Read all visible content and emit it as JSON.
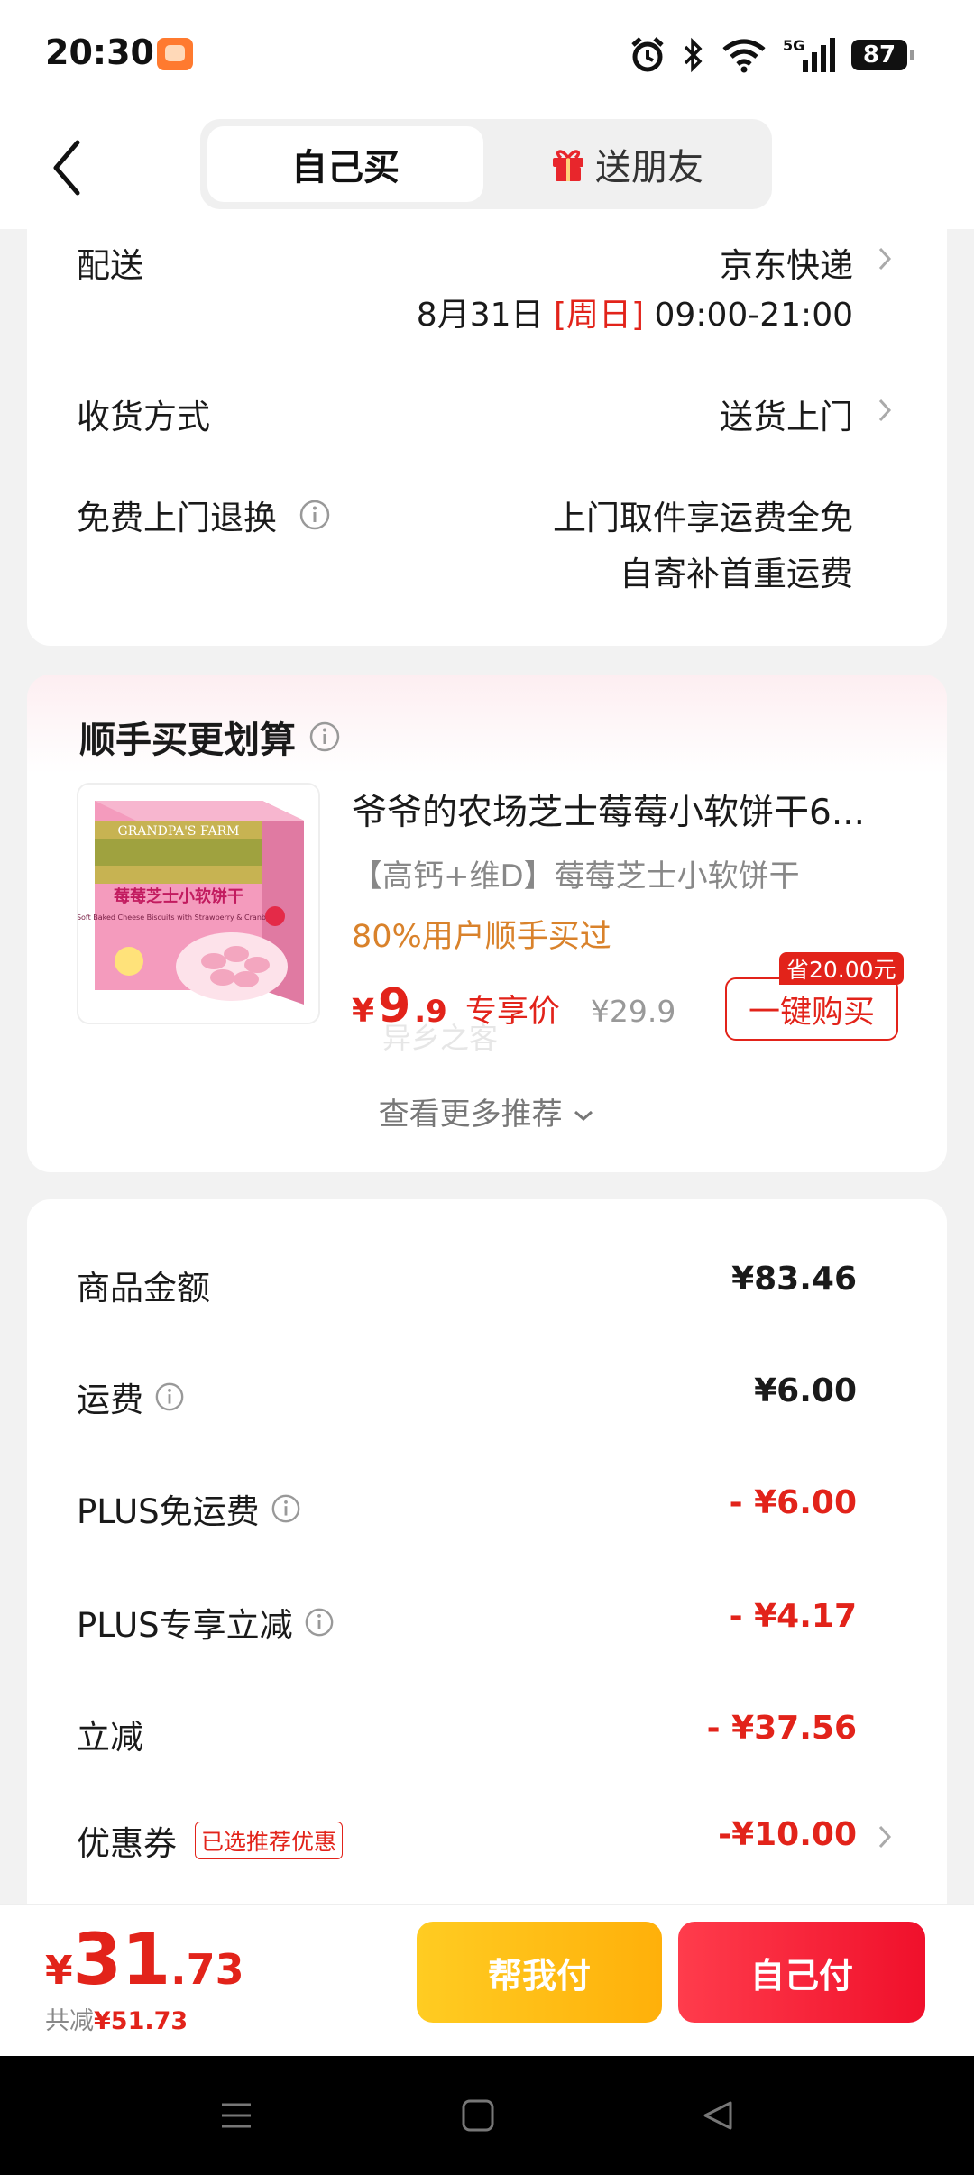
{
  "status_bar": {
    "time": "20:30",
    "battery": "87"
  },
  "header": {
    "tab_self": "自己买",
    "tab_gift": "送朋友"
  },
  "delivery": {
    "delivery_label": "配送",
    "carrier": "京东快递",
    "date": "8月31日",
    "weekday": "[周日]",
    "time_window": "09:00-21:00",
    "receive_label": "收货方式",
    "receive_value": "送货上门",
    "return_label": "免费上门退换",
    "return_line1": "上门取件享运费全免",
    "return_line2": "自寄补首重运费"
  },
  "recommend": {
    "title": "顺手买更划算",
    "product_name": "爷爷的农场芝士莓莓小软饼干6...",
    "product_sub": "【高钙+维D】莓莓芝士小软饼干",
    "product_tag": "80%用户顺手买过",
    "price_symbol": "¥",
    "price_int": "9",
    "price_dec": ".9",
    "price_label": "专享价",
    "original_price": "¥29.9",
    "save_badge": "省20.00元",
    "buy_button": "一键购买",
    "more": "查看更多推荐",
    "package_brand": "GRANDPA'S FARM",
    "package_title": "莓莓芝士小软饼干",
    "package_sub": "Soft Baked Cheese Biscuits with Strawberry & Cranberry"
  },
  "watermark": "异乡之客",
  "costs": [
    {
      "label": "商品金额",
      "value": "¥83.46",
      "info": false,
      "red": false
    },
    {
      "label": "运费",
      "value": "¥6.00",
      "info": true,
      "red": false
    },
    {
      "label": "PLUS免运费",
      "value": "- ¥6.00",
      "info": true,
      "red": true
    },
    {
      "label": "PLUS专享立减",
      "value": "- ¥4.17",
      "info": true,
      "red": true
    },
    {
      "label": "立减",
      "value": "- ¥37.56",
      "info": false,
      "red": true
    },
    {
      "label": "优惠券",
      "value": "-¥10.00",
      "info": false,
      "red": true,
      "tag": "已选推荐优惠"
    }
  ],
  "footer": {
    "total_symbol": "¥",
    "total_int": "31",
    "total_dec": ".73",
    "saved_label": "共减",
    "saved_value": "¥51.73",
    "help_pay": "帮我付",
    "self_pay": "自己付"
  },
  "colors": {
    "accent_red": "#e2231a",
    "yellow": "#ffbb11",
    "tag_orange": "#d9822b"
  },
  "icons": [
    "back-icon",
    "gift-icon",
    "info-icon",
    "chevron-right-icon",
    "chevron-down-icon",
    "alarm-icon",
    "bluetooth-icon",
    "wifi-icon",
    "signal-icon",
    "menu-icon",
    "home-icon",
    "back-triangle-icon"
  ]
}
